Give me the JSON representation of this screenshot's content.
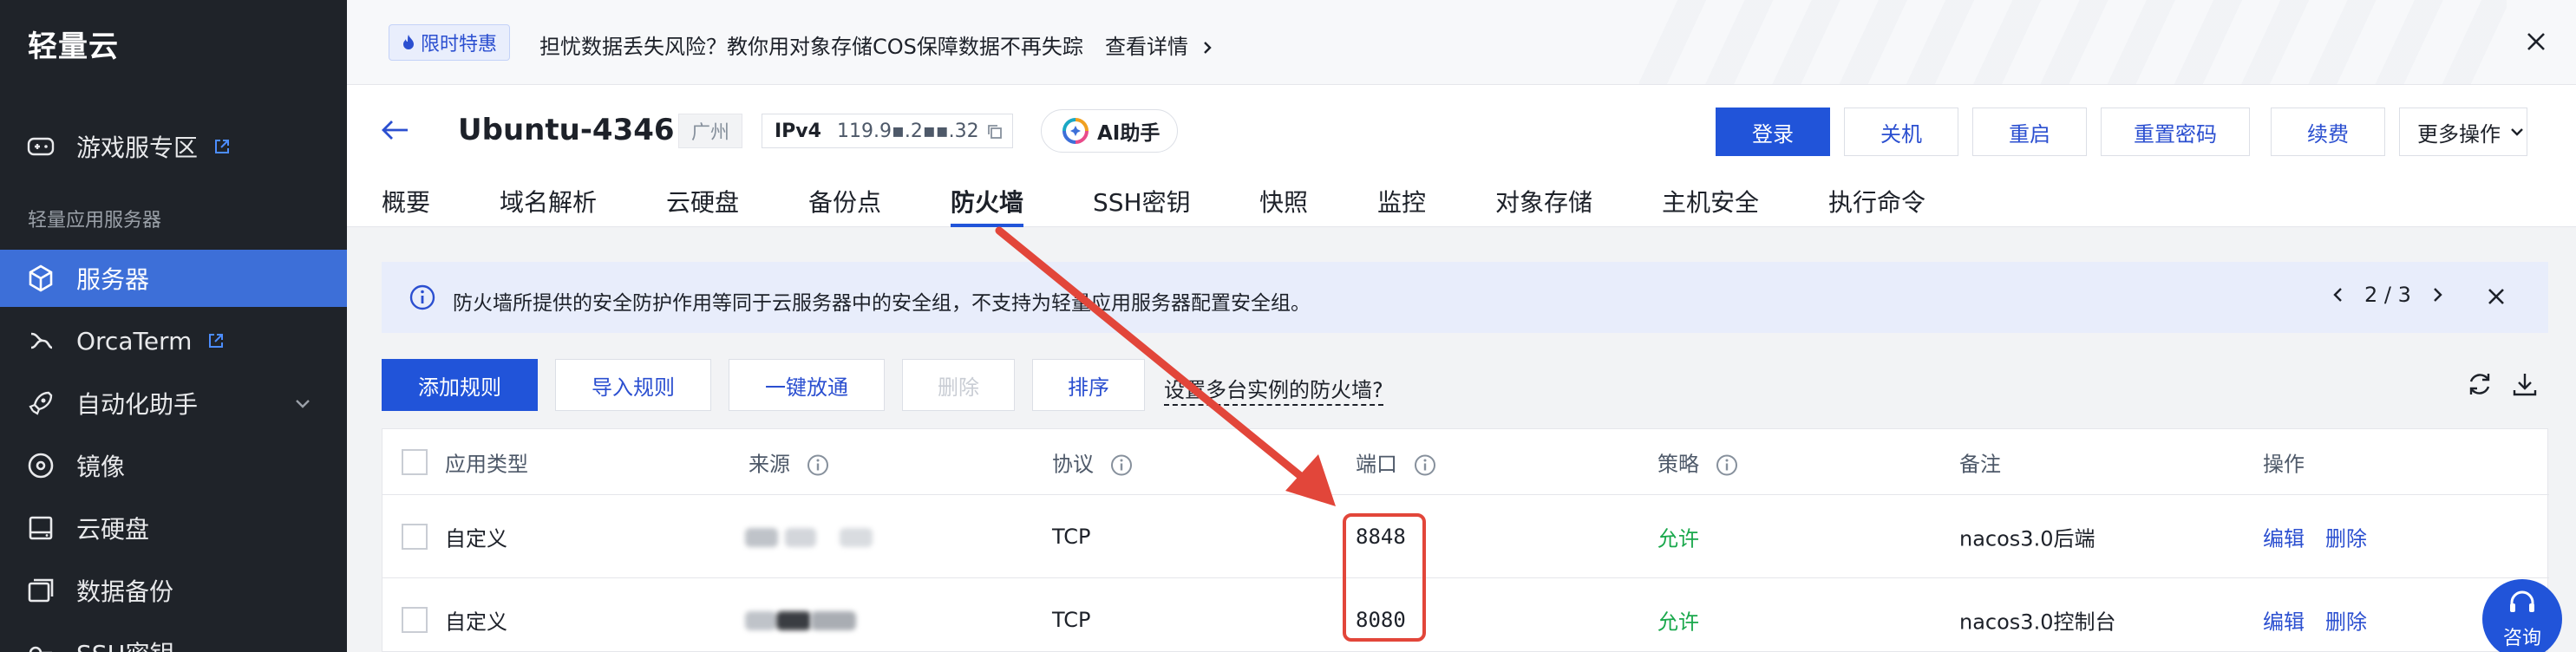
{
  "sidebar": {
    "brand": "轻量云",
    "section_label": "轻量应用服务器",
    "items": [
      {
        "label": "游戏服专区",
        "icon": "gamepad-icon",
        "external": true
      },
      {
        "label": "服务器",
        "icon": "cube-icon",
        "active": true
      },
      {
        "label": "OrcaTerm",
        "icon": "terminal-icon",
        "external": true
      },
      {
        "label": "自动化助手",
        "icon": "rocket-icon"
      },
      {
        "label": "镜像",
        "icon": "disc-icon"
      },
      {
        "label": "云硬盘",
        "icon": "disk-icon"
      },
      {
        "label": "数据备份",
        "icon": "backup-icon"
      },
      {
        "label": "SSH密钥",
        "icon": "key-icon"
      }
    ]
  },
  "promo": {
    "tag": "限时特惠",
    "text": "担忧数据丢失风险？教你用对象存储COS保障数据不再失踪",
    "link": "查看详情"
  },
  "header": {
    "title": "Ubuntu-4346",
    "region": "广州",
    "ip_label": "IPv4",
    "ip_value": "119.9▪.2▪▪.32",
    "ai_button": "AI助手",
    "buttons": {
      "login": "登录",
      "shutdown": "关机",
      "restart": "重启",
      "reset_password": "重置密码",
      "renew": "续费",
      "more": "更多操作"
    }
  },
  "tabs": [
    "概要",
    "域名解析",
    "云硬盘",
    "备份点",
    "防火墙",
    "SSH密钥",
    "快照",
    "监控",
    "对象存储",
    "主机安全",
    "执行命令"
  ],
  "active_tab": "防火墙",
  "notice": {
    "text": "防火墙所提供的安全防护作用等同于云服务器中的安全组，不支持为轻量应用服务器配置安全组。",
    "page": "2 / 3"
  },
  "toolbar": {
    "add_rule": "添加规则",
    "import_rule": "导入规则",
    "one_click_open": "一键放通",
    "delete": "删除",
    "sort": "排序",
    "help_link": "设置多台实例的防火墙?"
  },
  "table": {
    "headers": [
      "应用类型",
      "来源",
      "协议",
      "端口",
      "策略",
      "备注",
      "操作"
    ],
    "rows": [
      {
        "type": "自定义",
        "protocol": "TCP",
        "port": "8848",
        "policy": "允许",
        "remark": "nacos3.0后端",
        "edit": "编辑",
        "delete": "删除"
      },
      {
        "type": "自定义",
        "protocol": "TCP",
        "port": "8080",
        "policy": "允许",
        "remark": "nacos3.0控制台",
        "edit": "编辑",
        "delete": "删除"
      }
    ]
  },
  "consult_button": "咨询",
  "colors": {
    "primary": "#2154d9",
    "sidebar_bg": "#1f2329",
    "allow_green": "#1aa84c",
    "annotation_red": "#e2463a"
  }
}
